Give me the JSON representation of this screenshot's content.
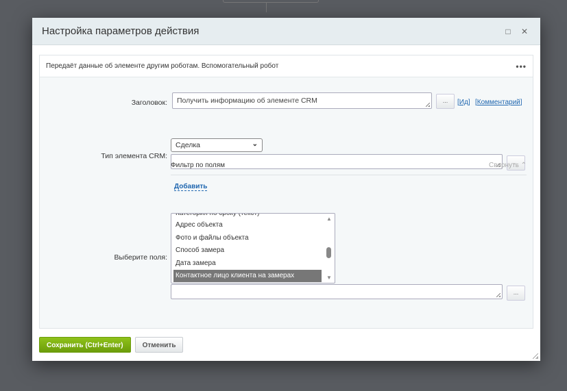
{
  "dialog": {
    "title": "Настройка параметров действия"
  },
  "description": "Передаёт данные об элементе другим роботам. Вспомогательный робот",
  "fields": {
    "title_label": "Заголовок:",
    "title_value": "Получить информацию об элементе CRM",
    "id_link": "Ид",
    "comment_link": "Комментарий",
    "dots_button": "...",
    "type_label": "Тип элемента CRM:",
    "type_value": "Сделка",
    "filter_title": "Фильтр по полям",
    "collapse": "Свернуть",
    "add": "Добавить",
    "select_fields_label": "Выберите поля:",
    "options": [
      "Категория по сроку (текст)",
      "Адрес объекта",
      "Фото и файлы объекта",
      "Способ замера",
      "Дата замера",
      "Контактное лицо клиента на замерах"
    ],
    "selected_option": "Контактное лицо клиента на замерах"
  },
  "footer": {
    "save": "Сохранить (Ctrl+Enter)",
    "cancel": "Отменить"
  }
}
